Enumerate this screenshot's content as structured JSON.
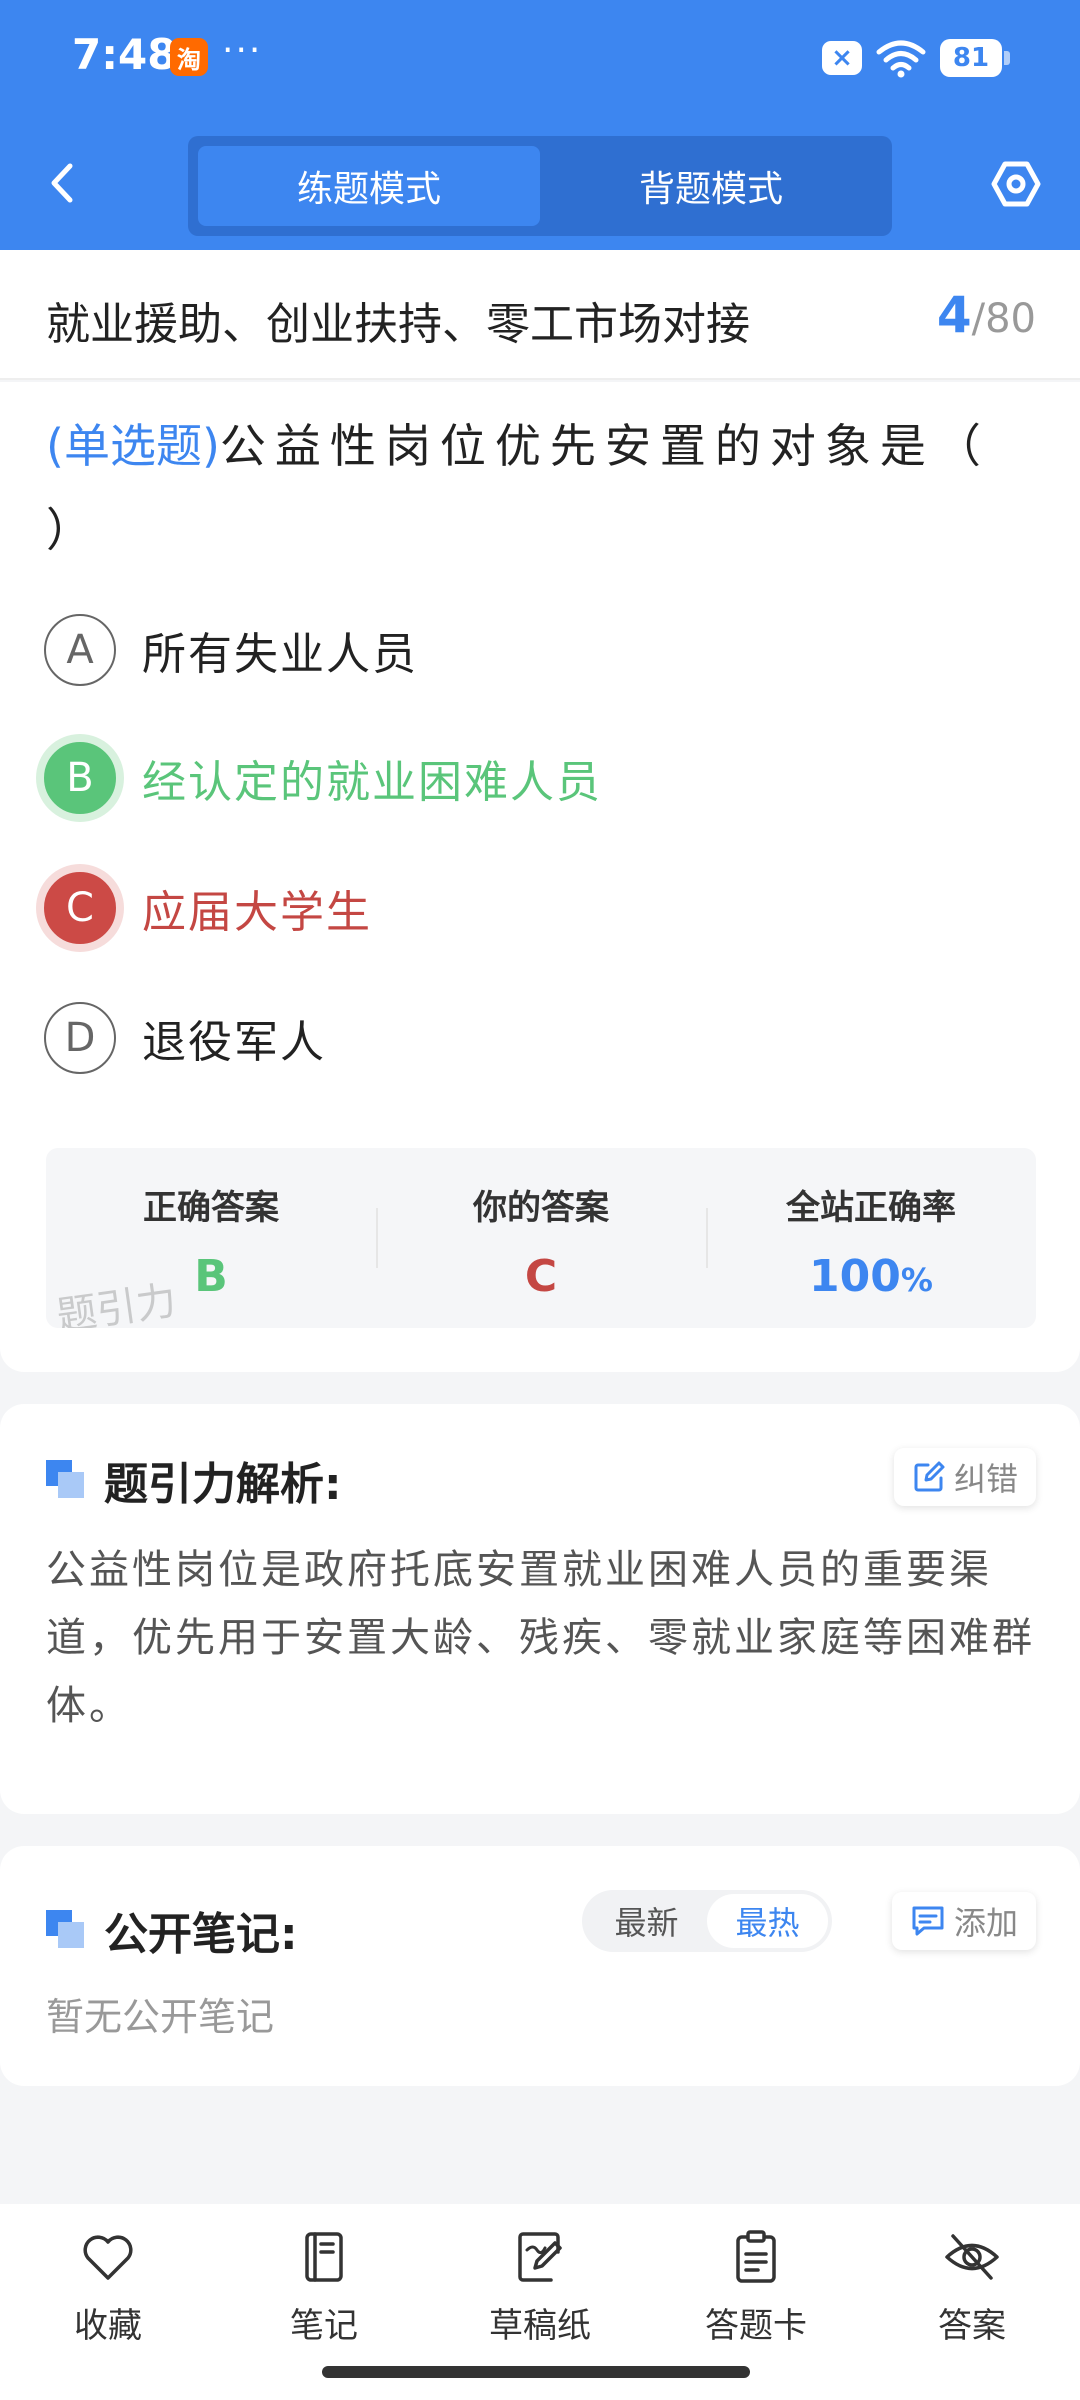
{
  "status_bar": {
    "time": "7:48",
    "app_badge": "淘",
    "dots": "···",
    "notification": "×",
    "battery": "81"
  },
  "header": {
    "back_glyph": "‹",
    "modes": [
      {
        "label": "练题模式",
        "active": true
      },
      {
        "label": "背题模式",
        "active": false
      }
    ]
  },
  "chapter": {
    "title": "就业援助、创业扶持、零工市场对接",
    "current": "4",
    "separator": "/",
    "total": "80"
  },
  "question": {
    "type": "(单选题)",
    "text": "公益性岗位优先安置的对象是（ ）",
    "options": [
      {
        "letter": "A",
        "text": "所有失业人员",
        "state": "normal"
      },
      {
        "letter": "B",
        "text": "经认定的就业困难人员",
        "state": "correct"
      },
      {
        "letter": "C",
        "text": "应届大学生",
        "state": "wrong"
      },
      {
        "letter": "D",
        "text": "退役军人",
        "state": "normal"
      }
    ]
  },
  "stats": {
    "correct_label": "正确答案",
    "correct_value": "B",
    "yours_label": "你的答案",
    "yours_value": "C",
    "rate_label": "全站正确率",
    "rate_value": "100",
    "rate_unit": "%",
    "watermark": "题引力"
  },
  "analysis": {
    "title": "题引力解析:",
    "report_label": "纠错",
    "text": "公益性岗位是政府托底安置就业困难人员的重要渠道，优先用于安置大龄、残疾、零就业家庭等困难群体。"
  },
  "notes": {
    "title": "公开笔记:",
    "sort_latest": "最新",
    "sort_hot": "最热",
    "add_label": "添加",
    "empty_text": "暂无公开笔记"
  },
  "toolbar": {
    "items": [
      {
        "label": "收藏",
        "icon": "heart-icon"
      },
      {
        "label": "笔记",
        "icon": "notebook-icon"
      },
      {
        "label": "草稿纸",
        "icon": "draft-pen-icon"
      },
      {
        "label": "答题卡",
        "icon": "clipboard-icon"
      },
      {
        "label": "答案",
        "icon": "eye-off-icon"
      }
    ]
  },
  "colors": {
    "primary": "#3d86f0",
    "correct": "#5ac57a",
    "wrong": "#c44743"
  }
}
